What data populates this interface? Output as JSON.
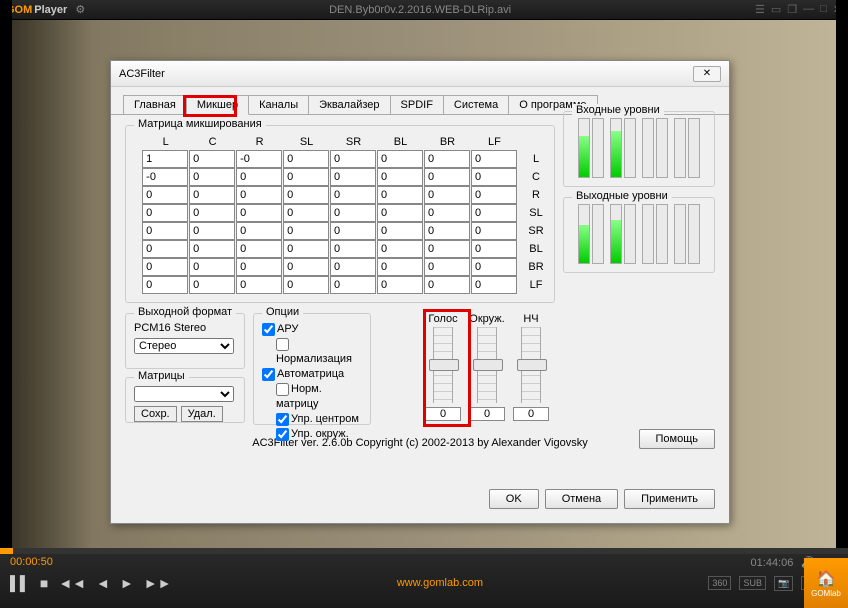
{
  "gom": {
    "logo1": "GOM",
    "logo2": "Player",
    "title_file": "DEN.Byb0r0v.2.2016.WEB-DLRip.avi",
    "pos": "00:00:50",
    "dur": "01:44:06",
    "url": "www.gomlab.com",
    "tray": "GOMlab"
  },
  "dialog": {
    "title": "AC3Filter",
    "tabs": [
      "Главная",
      "Микшер",
      "Каналы",
      "Эквалайзер",
      "SPDIF",
      "Система",
      "О программе"
    ],
    "matrix_label": "Матрица микширования",
    "col_headers": [
      "L",
      "C",
      "R",
      "SL",
      "SR",
      "BL",
      "BR",
      "LF"
    ],
    "row_labels": [
      "L",
      "C",
      "R",
      "SL",
      "SR",
      "BL",
      "BR",
      "LF"
    ],
    "matrix": [
      [
        "1",
        "0",
        "-0",
        "0",
        "0",
        "0",
        "0",
        "0"
      ],
      [
        "-0",
        "0",
        "0",
        "0",
        "0",
        "0",
        "0",
        "0"
      ],
      [
        "0",
        "0",
        "0",
        "0",
        "0",
        "0",
        "0",
        "0"
      ],
      [
        "0",
        "0",
        "0",
        "0",
        "0",
        "0",
        "0",
        "0"
      ],
      [
        "0",
        "0",
        "0",
        "0",
        "0",
        "0",
        "0",
        "0"
      ],
      [
        "0",
        "0",
        "0",
        "0",
        "0",
        "0",
        "0",
        "0"
      ],
      [
        "0",
        "0",
        "0",
        "0",
        "0",
        "0",
        "0",
        "0"
      ],
      [
        "0",
        "0",
        "0",
        "0",
        "0",
        "0",
        "0",
        "0"
      ]
    ],
    "in_levels_label": "Входные уровни",
    "out_levels_label": "Выходные уровни",
    "out_format_label": "Выходной формат",
    "out_format_value": "PCM16 Stereo",
    "out_format_select": "Стерео",
    "save_btn": "Сохр.",
    "del_btn": "Удал.",
    "matrices_label": "Матрицы",
    "options_label": "Опции",
    "opt_agc": "АРУ",
    "opt_norm": "Нормализация",
    "opt_automatrix": "Автоматрица",
    "opt_norm_matrix": "Норм. матрицу",
    "opt_ctrl_center": "Упр. центром",
    "opt_ctrl_surround": "Упр. окруж.",
    "voice_label": "Голос",
    "surround_label": "Окруж.",
    "lfe_label": "НЧ",
    "voice_val": "0",
    "surround_val": "0",
    "lfe_val": "0",
    "copyright": "AC3Filter ver. 2.6.0b Copyright (c) 2002-2013 by Alexander Vigovsky",
    "help": "Помощь",
    "ok": "OK",
    "cancel": "Отмена",
    "apply": "Применить"
  },
  "levels_in": [
    70,
    0,
    80,
    0,
    0,
    0,
    0,
    0
  ],
  "levels_out": [
    65,
    0,
    75,
    0,
    0,
    0,
    0,
    0
  ]
}
